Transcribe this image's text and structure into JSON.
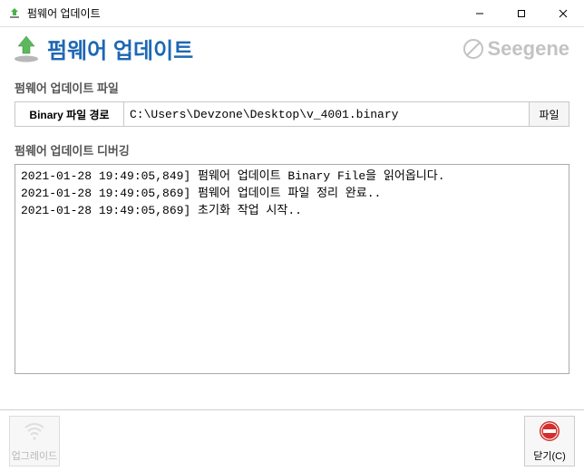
{
  "window": {
    "title": "펌웨어 업데이트"
  },
  "header": {
    "title": "펌웨어 업데이트",
    "brand": "Seegene"
  },
  "file_section": {
    "label": "펌웨어 업데이트 파일",
    "path_label": "Binary 파일 경로",
    "path_value": "C:\\Users\\Devzone\\Desktop\\v_4001.binary",
    "browse_button": "파일"
  },
  "debug_section": {
    "label": "펌웨어 업데이트 디버깅",
    "lines": [
      "2021-01-28 19:49:05,849] 펌웨어 업데이트 Binary File을 읽어옵니다.",
      "2021-01-28 19:49:05,869] 펌웨어 업데이트 파일 정리 완료..",
      "2021-01-28 19:49:05,869] 초기화 작업 시작.."
    ]
  },
  "footer": {
    "upgrade_label": "업그레이드",
    "close_label": "닫기(C)"
  }
}
